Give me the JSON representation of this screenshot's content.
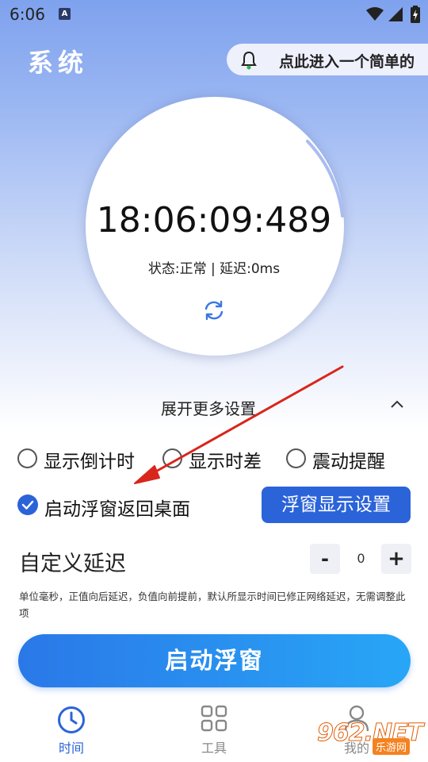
{
  "status_bar": {
    "time": "6:06",
    "notif_icon": "A"
  },
  "header": {
    "title": "系统",
    "notice": "点此进入一个简单的"
  },
  "clock": {
    "time": "18:06:09:489",
    "status": "状态:正常 | 延迟:0ms"
  },
  "settings": {
    "expand_label": "展开更多设置",
    "options": [
      {
        "label": "显示倒计时",
        "checked": false
      },
      {
        "label": "显示时差",
        "checked": false
      },
      {
        "label": "震动提醒",
        "checked": false
      }
    ],
    "return_desktop": {
      "label": "启动浮窗返回桌面",
      "checked": true
    },
    "float_settings_label": "浮窗显示设置"
  },
  "delay": {
    "label": "自定义延迟",
    "minus": "-",
    "value": "0",
    "plus": "+",
    "hint": "单位毫秒，正值向后延迟，负值向前提前，默认所显示时间已修正网络延迟，无需调整此项"
  },
  "start_button": "启动浮窗",
  "nav": {
    "items": [
      {
        "label": "时间",
        "icon": "clock-icon",
        "active": true
      },
      {
        "label": "工具",
        "icon": "grid-icon",
        "active": false
      },
      {
        "label": "我的",
        "icon": "person-icon",
        "active": false
      }
    ]
  },
  "watermark": {
    "main": "962.NET",
    "sub": "乐游网"
  },
  "colors": {
    "accent": "#2b63d9",
    "nav_active": "#2b63d9",
    "nav_inactive": "#888888",
    "arrow": "#d9261c"
  }
}
